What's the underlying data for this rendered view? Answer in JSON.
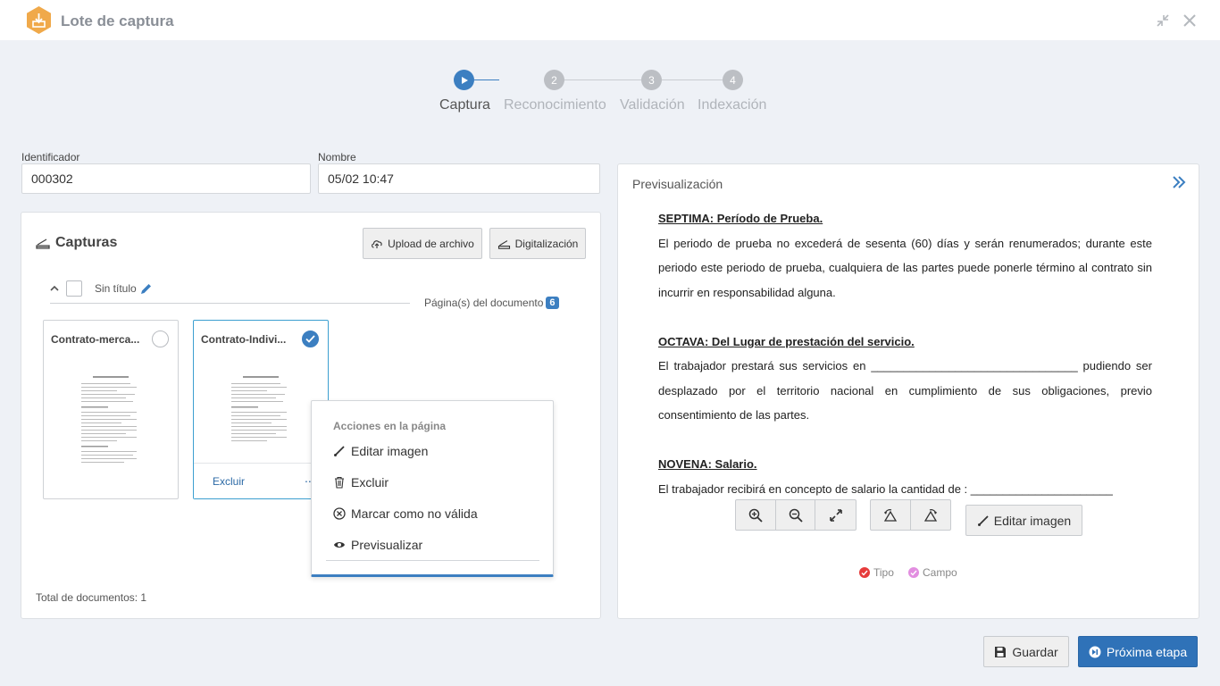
{
  "header": {
    "title": "Lote de captura",
    "logo_icon": "upload-box-icon"
  },
  "colors": {
    "accent": "#3c7fc1",
    "logo": "#f0a94a",
    "tipo": "#e63b3b",
    "campo": "#e28ee0"
  },
  "stepper": {
    "steps": [
      {
        "label": "Captura",
        "number": "",
        "active": true
      },
      {
        "label": "Reconocimiento",
        "number": "2",
        "active": false
      },
      {
        "label": "Validación",
        "number": "3",
        "active": false
      },
      {
        "label": "Indexación",
        "number": "4",
        "active": false
      }
    ]
  },
  "fields": {
    "identificador": {
      "label": "Identificador",
      "value": "000302"
    },
    "nombre": {
      "label": "Nombre",
      "value": "05/02 10:47"
    }
  },
  "capturas": {
    "title": "Capturas",
    "upload_label": "Upload de archivo",
    "scan_label": "Digitalización",
    "group_title": "Sin título",
    "pages_label": "Página(s) del documento",
    "pages_count": "6",
    "documents": [
      {
        "name": "Contrato-merca...",
        "selected": false
      },
      {
        "name": "Contrato-Indivi...",
        "selected": true,
        "delete_label": "Excluir",
        "more_label": "..."
      }
    ],
    "total_label": "Total de documentos: 1"
  },
  "context_menu": {
    "heading": "Acciones en la página",
    "items": [
      {
        "label": "Editar imagen",
        "icon": "brush-icon"
      },
      {
        "label": "Excluir",
        "icon": "trash-icon"
      },
      {
        "label": "Marcar como no válida",
        "icon": "circle-x-icon"
      },
      {
        "label": "Previsualizar",
        "icon": "eye-icon"
      }
    ]
  },
  "preview": {
    "title": "Previsualización",
    "sections": [
      {
        "heading": "SEPTIMA: Período de Prueba.",
        "body": "El periodo de prueba no excederá de sesenta (60) días y serán renumerados; durante este periodo este periodo de prueba, cualquiera de las partes puede ponerle término al contrato sin incurrir en responsabilidad alguna."
      },
      {
        "heading": "OCTAVA: Del Lugar de prestación del servicio.",
        "body": "El trabajador prestará sus servicios en ________________________________ pudiendo ser desplazado por el territorio nacional en cumplimiento de sus obligaciones, previo consentimiento de las partes."
      },
      {
        "heading": "NOVENA: Salario.",
        "body": "El trabajador recibirá en concepto de salario la cantidad de : ______________________"
      }
    ],
    "edit_image_label": "Editar imagen",
    "legend": {
      "tipo": "Tipo",
      "campo": "Campo"
    }
  },
  "footer": {
    "save_label": "Guardar",
    "next_label": "Próxima etapa"
  }
}
